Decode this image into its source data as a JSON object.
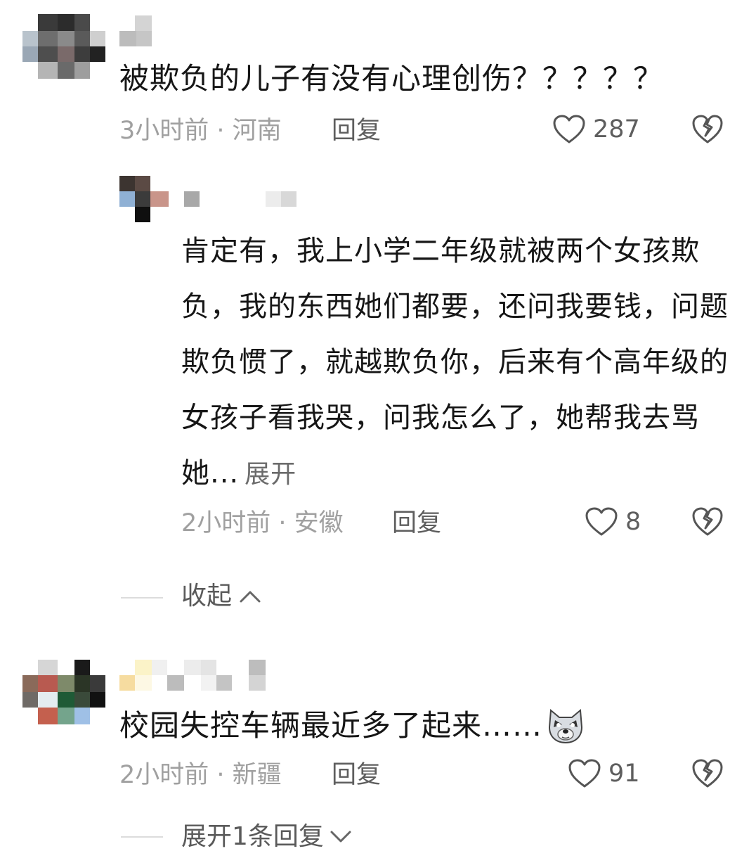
{
  "comments": [
    {
      "text": "被欺负的儿子有没有心理创伤？？？？？",
      "meta": "3小时前 · 河南",
      "reply_label": "回复",
      "likes": "287",
      "reply": {
        "text": "肯定有，我上小学二年级就被两个女孩欺负，我的东西她们都要，还问我要钱，问题欺负惯了，就越欺负你，后来有个高年级的女孩子看我哭，问我怎么了，她帮我去骂她...",
        "expand_label": "展开",
        "meta": "2小时前 · 安徽",
        "reply_label": "回复",
        "likes": "8"
      },
      "collapse_label": "收起"
    },
    {
      "text": "校园失控车辆最近多了起来……",
      "emoji": "wolf-emoji",
      "meta": "2小时前 · 新疆",
      "reply_label": "回复",
      "likes": "91",
      "expand_replies_label": "展开1条回复"
    }
  ],
  "icons": [
    "heart-outline-icon",
    "broken-heart-icon",
    "chevron-up-icon",
    "chevron-down-icon"
  ],
  "colors": {
    "text": "#161616",
    "meta": "#a0a0a0",
    "action": "#5e5e5e",
    "divider": "#dcdcdc"
  }
}
